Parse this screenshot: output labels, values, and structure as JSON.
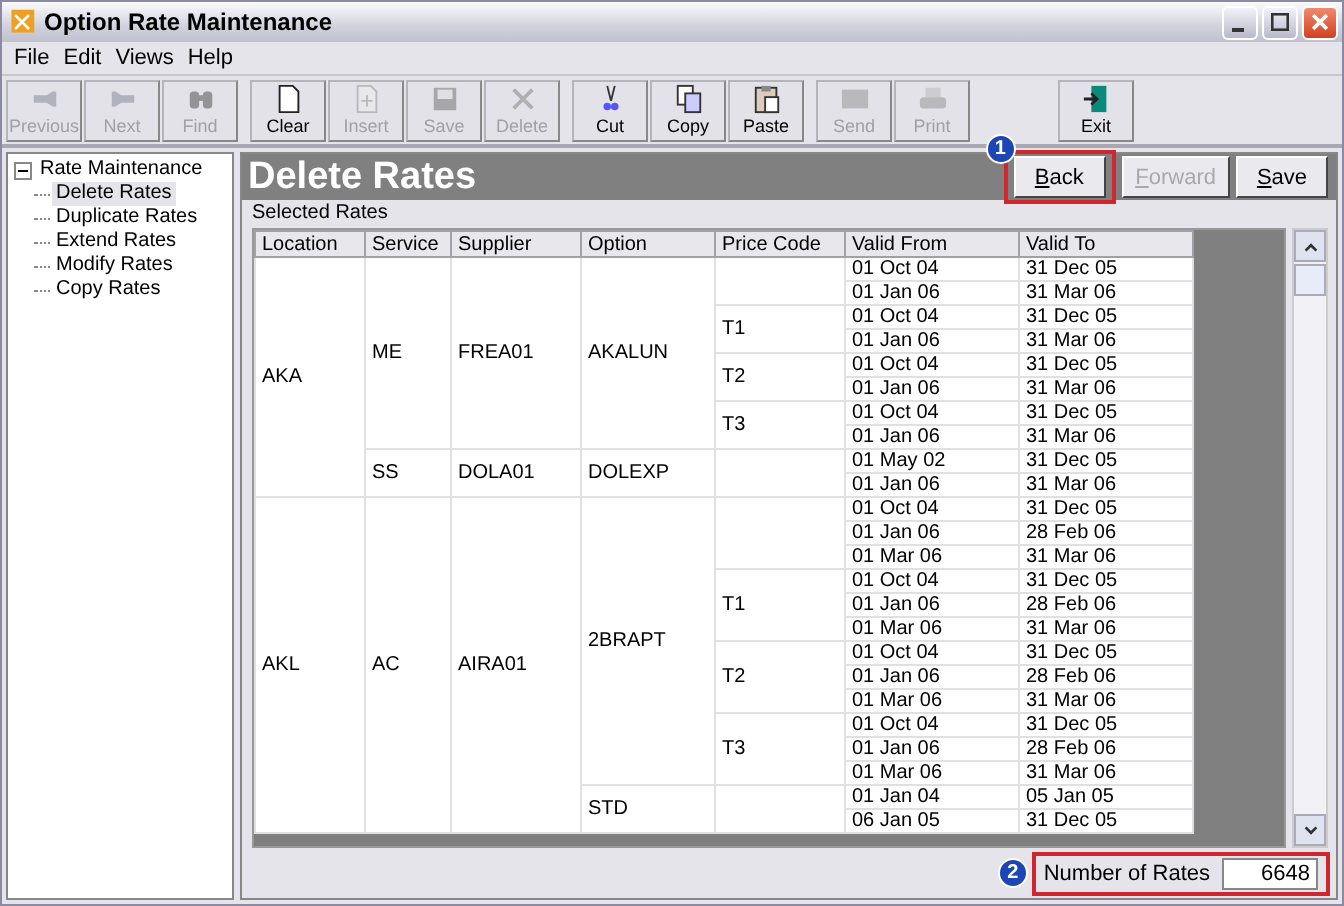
{
  "window": {
    "title": "Option Rate Maintenance"
  },
  "menu": [
    "File",
    "Edit",
    "Views",
    "Help"
  ],
  "toolbar": [
    [
      {
        "label": "Previous",
        "disabled": true
      },
      {
        "label": "Next",
        "disabled": true
      },
      {
        "label": "Find",
        "disabled": true
      }
    ],
    [
      {
        "label": "Clear",
        "disabled": false
      },
      {
        "label": "Insert",
        "disabled": true
      },
      {
        "label": "Save",
        "disabled": true
      },
      {
        "label": "Delete",
        "disabled": true
      }
    ],
    [
      {
        "label": "Cut",
        "disabled": false
      },
      {
        "label": "Copy",
        "disabled": false
      },
      {
        "label": "Paste",
        "disabled": false
      }
    ],
    [
      {
        "label": "Send",
        "disabled": true
      },
      {
        "label": "Print",
        "disabled": true
      }
    ],
    [
      {
        "label": "Exit",
        "disabled": false
      }
    ]
  ],
  "sidebar": {
    "items": [
      {
        "label": "Rate Maintenance",
        "expanded": true,
        "selected": false,
        "children": [
          {
            "label": "Delete Rates",
            "selected": true
          },
          {
            "label": "Duplicate Rates",
            "selected": false
          },
          {
            "label": "Extend Rates",
            "selected": false
          },
          {
            "label": "Modify Rates",
            "selected": false
          },
          {
            "label": "Copy Rates",
            "selected": false
          }
        ]
      }
    ]
  },
  "header": {
    "title": "Delete Rates",
    "buttons": [
      {
        "label": "Back",
        "disabled": false,
        "callout": "1"
      },
      {
        "label": "Forward",
        "disabled": true
      },
      {
        "label": "Save",
        "disabled": false
      }
    ]
  },
  "table": {
    "caption": "Selected Rates",
    "columns": [
      "Location",
      "Service",
      "Supplier",
      "Option",
      "Price Code",
      "Valid From",
      "Valid To"
    ],
    "groups": [
      {
        "location": "AKA",
        "services": [
          {
            "service": "ME",
            "supplier": "FREA01",
            "options": [
              {
                "option": "AKALUN",
                "price_codes": [
                  {
                    "rates": [
                      {
                        "from": "01 Oct 04",
                        "to": "31 Dec 05"
                      },
                      {
                        "from": "01 Jan 06",
                        "to": "31 Mar 06"
                      }
                    ]
                  },
                  {
                    "code": "T1",
                    "rates": [
                      {
                        "from": "01 Oct 04",
                        "to": "31 Dec 05"
                      },
                      {
                        "from": "01 Jan 06",
                        "to": "31 Mar 06"
                      }
                    ]
                  },
                  {
                    "code": "T2",
                    "rates": [
                      {
                        "from": "01 Oct 04",
                        "to": "31 Dec 05"
                      },
                      {
                        "from": "01 Jan 06",
                        "to": "31 Mar 06"
                      }
                    ]
                  },
                  {
                    "code": "T3",
                    "rates": [
                      {
                        "from": "01 Oct 04",
                        "to": "31 Dec 05"
                      },
                      {
                        "from": "01 Jan 06",
                        "to": "31 Mar 06"
                      }
                    ]
                  }
                ]
              }
            ]
          },
          {
            "service": "SS",
            "supplier": "DOLA01",
            "options": [
              {
                "option": "DOLEXP",
                "price_codes": [
                  {
                    "rates": [
                      {
                        "from": "01 May 02",
                        "to": "31 Dec 05"
                      },
                      {
                        "from": "01 Jan 06",
                        "to": "31 Mar 06"
                      }
                    ]
                  }
                ]
              }
            ]
          }
        ]
      },
      {
        "location": "AKL",
        "services": [
          {
            "service": "AC",
            "supplier": "AIRA01",
            "options": [
              {
                "option": "2BRAPT",
                "price_codes": [
                  {
                    "rates": [
                      {
                        "from": "01 Oct 04",
                        "to": "31 Dec 05"
                      },
                      {
                        "from": "01 Jan 06",
                        "to": "28 Feb 06"
                      },
                      {
                        "from": "01 Mar 06",
                        "to": "31 Mar 06"
                      }
                    ]
                  },
                  {
                    "code": "T1",
                    "rates": [
                      {
                        "from": "01 Oct 04",
                        "to": "31 Dec 05"
                      },
                      {
                        "from": "01 Jan 06",
                        "to": "28 Feb 06"
                      },
                      {
                        "from": "01 Mar 06",
                        "to": "31 Mar 06"
                      }
                    ]
                  },
                  {
                    "code": "T2",
                    "rates": [
                      {
                        "from": "01 Oct 04",
                        "to": "31 Dec 05"
                      },
                      {
                        "from": "01 Jan 06",
                        "to": "28 Feb 06"
                      },
                      {
                        "from": "01 Mar 06",
                        "to": "31 Mar 06"
                      }
                    ]
                  },
                  {
                    "code": "T3",
                    "rates": [
                      {
                        "from": "01 Oct 04",
                        "to": "31 Dec 05"
                      },
                      {
                        "from": "01 Jan 06",
                        "to": "28 Feb 06"
                      },
                      {
                        "from": "01 Mar 06",
                        "to": "31 Mar 06"
                      }
                    ]
                  }
                ]
              },
              {
                "option": "STD",
                "price_codes": [
                  {
                    "rates": [
                      {
                        "from": "01 Jan 04",
                        "to": "05 Jan 05"
                      },
                      {
                        "from": "06 Jan 05",
                        "to": "31 Dec 05"
                      }
                    ]
                  }
                ]
              }
            ]
          }
        ]
      }
    ]
  },
  "footer": {
    "label": "Number of Rates",
    "value": "6648",
    "callout": "2"
  }
}
